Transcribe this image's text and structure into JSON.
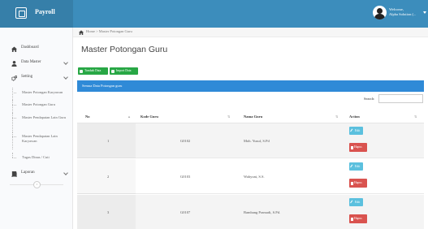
{
  "app": {
    "title": "Payroll",
    "user_name": "Welcome,",
    "user_detail": "Alpha Solution (..."
  },
  "sidebar": {
    "items": [
      {
        "label": "Dashboard",
        "icon": "dashboard-icon"
      },
      {
        "label": "Data Master",
        "icon": "user-icon"
      },
      {
        "label": "Setting",
        "icon": "cogs-icon"
      }
    ],
    "sub_items": [
      {
        "label": "Master Potongan Karyawan"
      },
      {
        "label": "Master Potongan Guru"
      },
      {
        "label": "Master Pendapatan Lain Guru"
      },
      {
        "label": "Master Pendapatan Lain Karyawan"
      },
      {
        "label": "Tugas Dinas / Cuti"
      }
    ],
    "laporan": {
      "label": "Laporan",
      "icon": "book-icon"
    },
    "collapse_symbol": "‹"
  },
  "breadcrumb": {
    "text": "Home > Master Potongan Guru"
  },
  "page": {
    "title": "Master Potongan Guru",
    "add_label": "Tambah Data",
    "import_label": "Import Data",
    "panel_title": "Semua Data Potongan guru",
    "search_label": "Search:",
    "search_value": ""
  },
  "table": {
    "headers": [
      "No",
      "Kode Guru",
      "Nama Guru",
      "Action"
    ],
    "sort_indicators": [
      "▲",
      "⇅",
      "⇅",
      "⇅"
    ],
    "edit_label": "Edit",
    "delete_label": "Hapus",
    "rows": [
      {
        "no": "1",
        "kode": "G0102",
        "nama": "Moh. Yusuf, S.Pd"
      },
      {
        "no": "2",
        "kode": "G0103",
        "nama": "Wahyuni, S.S."
      },
      {
        "no": "3",
        "kode": "G0107",
        "nama": "Bambang Pramadi, S.Pd."
      }
    ]
  },
  "colors": {
    "topbar": "#3c8dbc",
    "brand": "#367fa9",
    "panel_head": "#2f8ad7",
    "green": "#28a745",
    "info": "#5bc0de",
    "danger": "#d9534f"
  }
}
